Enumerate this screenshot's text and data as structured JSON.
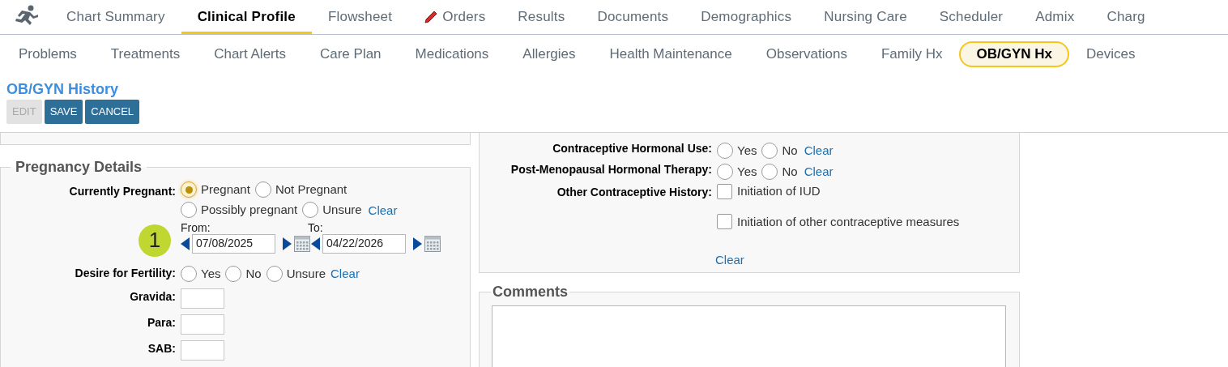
{
  "top_nav": [
    {
      "label": "Chart Summary",
      "selected": false
    },
    {
      "label": "Clinical Profile",
      "selected": true
    },
    {
      "label": "Flowsheet",
      "selected": false
    },
    {
      "label": "Orders",
      "selected": false,
      "has_icon": true
    },
    {
      "label": "Results",
      "selected": false
    },
    {
      "label": "Documents",
      "selected": false
    },
    {
      "label": "Demographics",
      "selected": false
    },
    {
      "label": "Nursing Care",
      "selected": false
    },
    {
      "label": "Scheduler",
      "selected": false
    },
    {
      "label": "Admix",
      "selected": false
    },
    {
      "label": "Charg",
      "selected": false
    }
  ],
  "sub_nav": [
    {
      "label": "Problems",
      "selected": false
    },
    {
      "label": "Treatments",
      "selected": false
    },
    {
      "label": "Chart Alerts",
      "selected": false
    },
    {
      "label": "Care Plan",
      "selected": false
    },
    {
      "label": "Medications",
      "selected": false
    },
    {
      "label": "Allergies",
      "selected": false
    },
    {
      "label": "Health Maintenance",
      "selected": false
    },
    {
      "label": "Observations",
      "selected": false
    },
    {
      "label": "Family Hx",
      "selected": false
    },
    {
      "label": "OB/GYN Hx",
      "selected": true
    },
    {
      "label": "Devices",
      "selected": false
    }
  ],
  "page_title": "OB/GYN History",
  "actions": [
    {
      "label": "EDIT",
      "disabled": true
    },
    {
      "label": "SAVE",
      "disabled": false
    },
    {
      "label": "CANCEL",
      "disabled": false
    }
  ],
  "pregnancy": {
    "legend": "Pregnancy Details",
    "currently_pregnant": {
      "label": "Currently Pregnant:",
      "options": [
        {
          "label": "Pregnant",
          "selected": true
        },
        {
          "label": "Not Pregnant",
          "selected": false
        },
        {
          "label": "Possibly pregnant",
          "selected": false
        },
        {
          "label": "Unsure",
          "selected": false
        }
      ],
      "clear": "Clear"
    },
    "step_marker": "1",
    "from_label": "From:",
    "from_value": "07/08/2025",
    "to_label": "To:",
    "to_value": "04/22/2026",
    "fertility": {
      "label": "Desire for Fertility:",
      "options": [
        {
          "label": "Yes",
          "selected": false
        },
        {
          "label": "No",
          "selected": false
        },
        {
          "label": "Unsure",
          "selected": false
        }
      ],
      "clear": "Clear"
    },
    "counts": [
      {
        "label": "Gravida:"
      },
      {
        "label": "Para:"
      },
      {
        "label": "SAB:"
      }
    ]
  },
  "contraception": {
    "radio_rows": [
      {
        "label": "Contraceptive Hormonal Use:",
        "options": [
          {
            "label": "Yes",
            "selected": false
          },
          {
            "label": "No",
            "selected": false
          }
        ],
        "clear": "Clear"
      },
      {
        "label": "Post-Menopausal Hormonal Therapy:",
        "options": [
          {
            "label": "Yes",
            "selected": false
          },
          {
            "label": "No",
            "selected": false
          }
        ],
        "clear": "Clear"
      }
    ],
    "other": {
      "label": "Other Contraceptive History:",
      "options": [
        {
          "label": "Initiation of IUD",
          "checked": false
        },
        {
          "label": "Initiation of other contraceptive measures",
          "checked": false
        }
      ],
      "clear": "Clear"
    }
  },
  "comments": {
    "legend": "Comments"
  }
}
